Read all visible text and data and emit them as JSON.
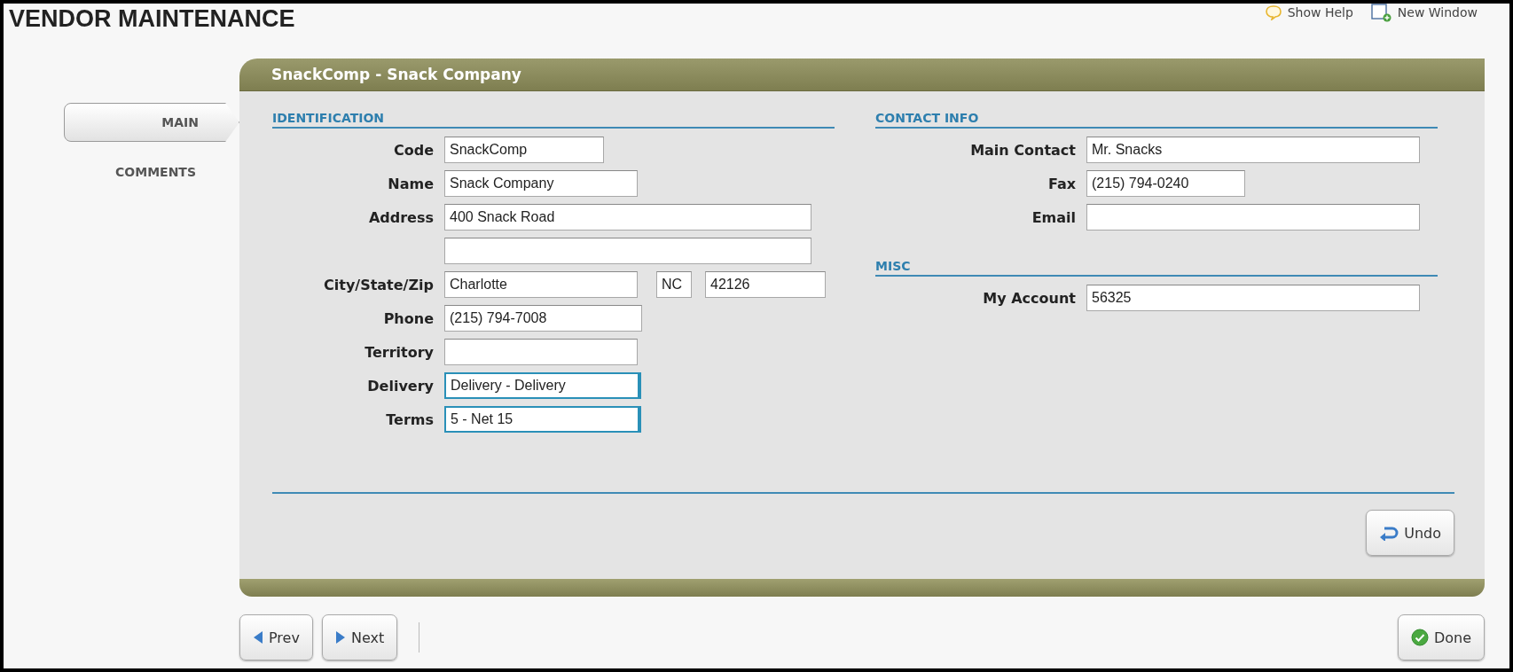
{
  "page": {
    "title": "VENDOR MAINTENANCE"
  },
  "header_links": [
    {
      "label": "Show Help",
      "kind": "help"
    },
    {
      "label": "New Window",
      "kind": "window"
    }
  ],
  "tabs": [
    {
      "label": "MAIN",
      "selected": true
    },
    {
      "label": "COMMENTS",
      "selected": false
    }
  ],
  "panel": {
    "title": "SnackComp - Snack Company"
  },
  "columns": [
    {
      "sections": [
        {
          "title": "IDENTIFICATION",
          "rows": [
            {
              "label": "Code",
              "fields": [
                {
                  "value": "SnackComp",
                  "kind": "text"
                }
              ]
            },
            {
              "label": "Name",
              "fields": [
                {
                  "value": "Snack Company",
                  "kind": "text"
                }
              ]
            },
            {
              "label": "Address",
              "fields": [
                {
                  "value": "400 Snack Road",
                  "kind": "text"
                }
              ]
            },
            {
              "fields": [
                {
                  "kind": "text"
                }
              ]
            },
            {
              "label": "City/State/Zip",
              "fields": [
                {
                  "value": "Charlotte",
                  "kind": "text"
                },
                {
                  "value": "NC",
                  "kind": "text"
                },
                {
                  "value": "42126",
                  "kind": "text"
                }
              ]
            },
            {
              "label": "Phone",
              "fields": [
                {
                  "value": "(215) 794-7008",
                  "kind": "text"
                }
              ]
            },
            {
              "label": "Territory",
              "fields": [
                {
                  "kind": "text"
                }
              ]
            },
            {
              "label": "Delivery",
              "fields": [
                {
                  "value": "Delivery - Delivery",
                  "kind": "lookup"
                }
              ]
            },
            {
              "label": "Terms",
              "fields": [
                {
                  "value": "5 - Net 15",
                  "kind": "lookup"
                }
              ]
            }
          ]
        }
      ]
    },
    {
      "sections": [
        {
          "title": "CONTACT INFO",
          "rows": [
            {
              "label": "Main Contact",
              "fields": [
                {
                  "value": "Mr. Snacks",
                  "kind": "text"
                }
              ]
            },
            {
              "label": "Fax",
              "fields": [
                {
                  "value": "(215) 794-0240",
                  "kind": "text"
                }
              ]
            },
            {
              "label": "Email",
              "fields": [
                {
                  "kind": "text"
                }
              ]
            }
          ]
        },
        {
          "title": "MISC",
          "rows": [
            {
              "label": "My Account",
              "fields": [
                {
                  "value": "56325",
                  "kind": "text"
                }
              ]
            }
          ]
        }
      ]
    }
  ],
  "panel_buttons": [
    {
      "label": "Undo",
      "kind": "undo"
    }
  ],
  "footer_buttons": [
    {
      "label": "Prev",
      "kind": "prev"
    },
    {
      "label": "Next",
      "kind": "next"
    },
    {
      "label": "Done",
      "kind": "done"
    }
  ]
}
